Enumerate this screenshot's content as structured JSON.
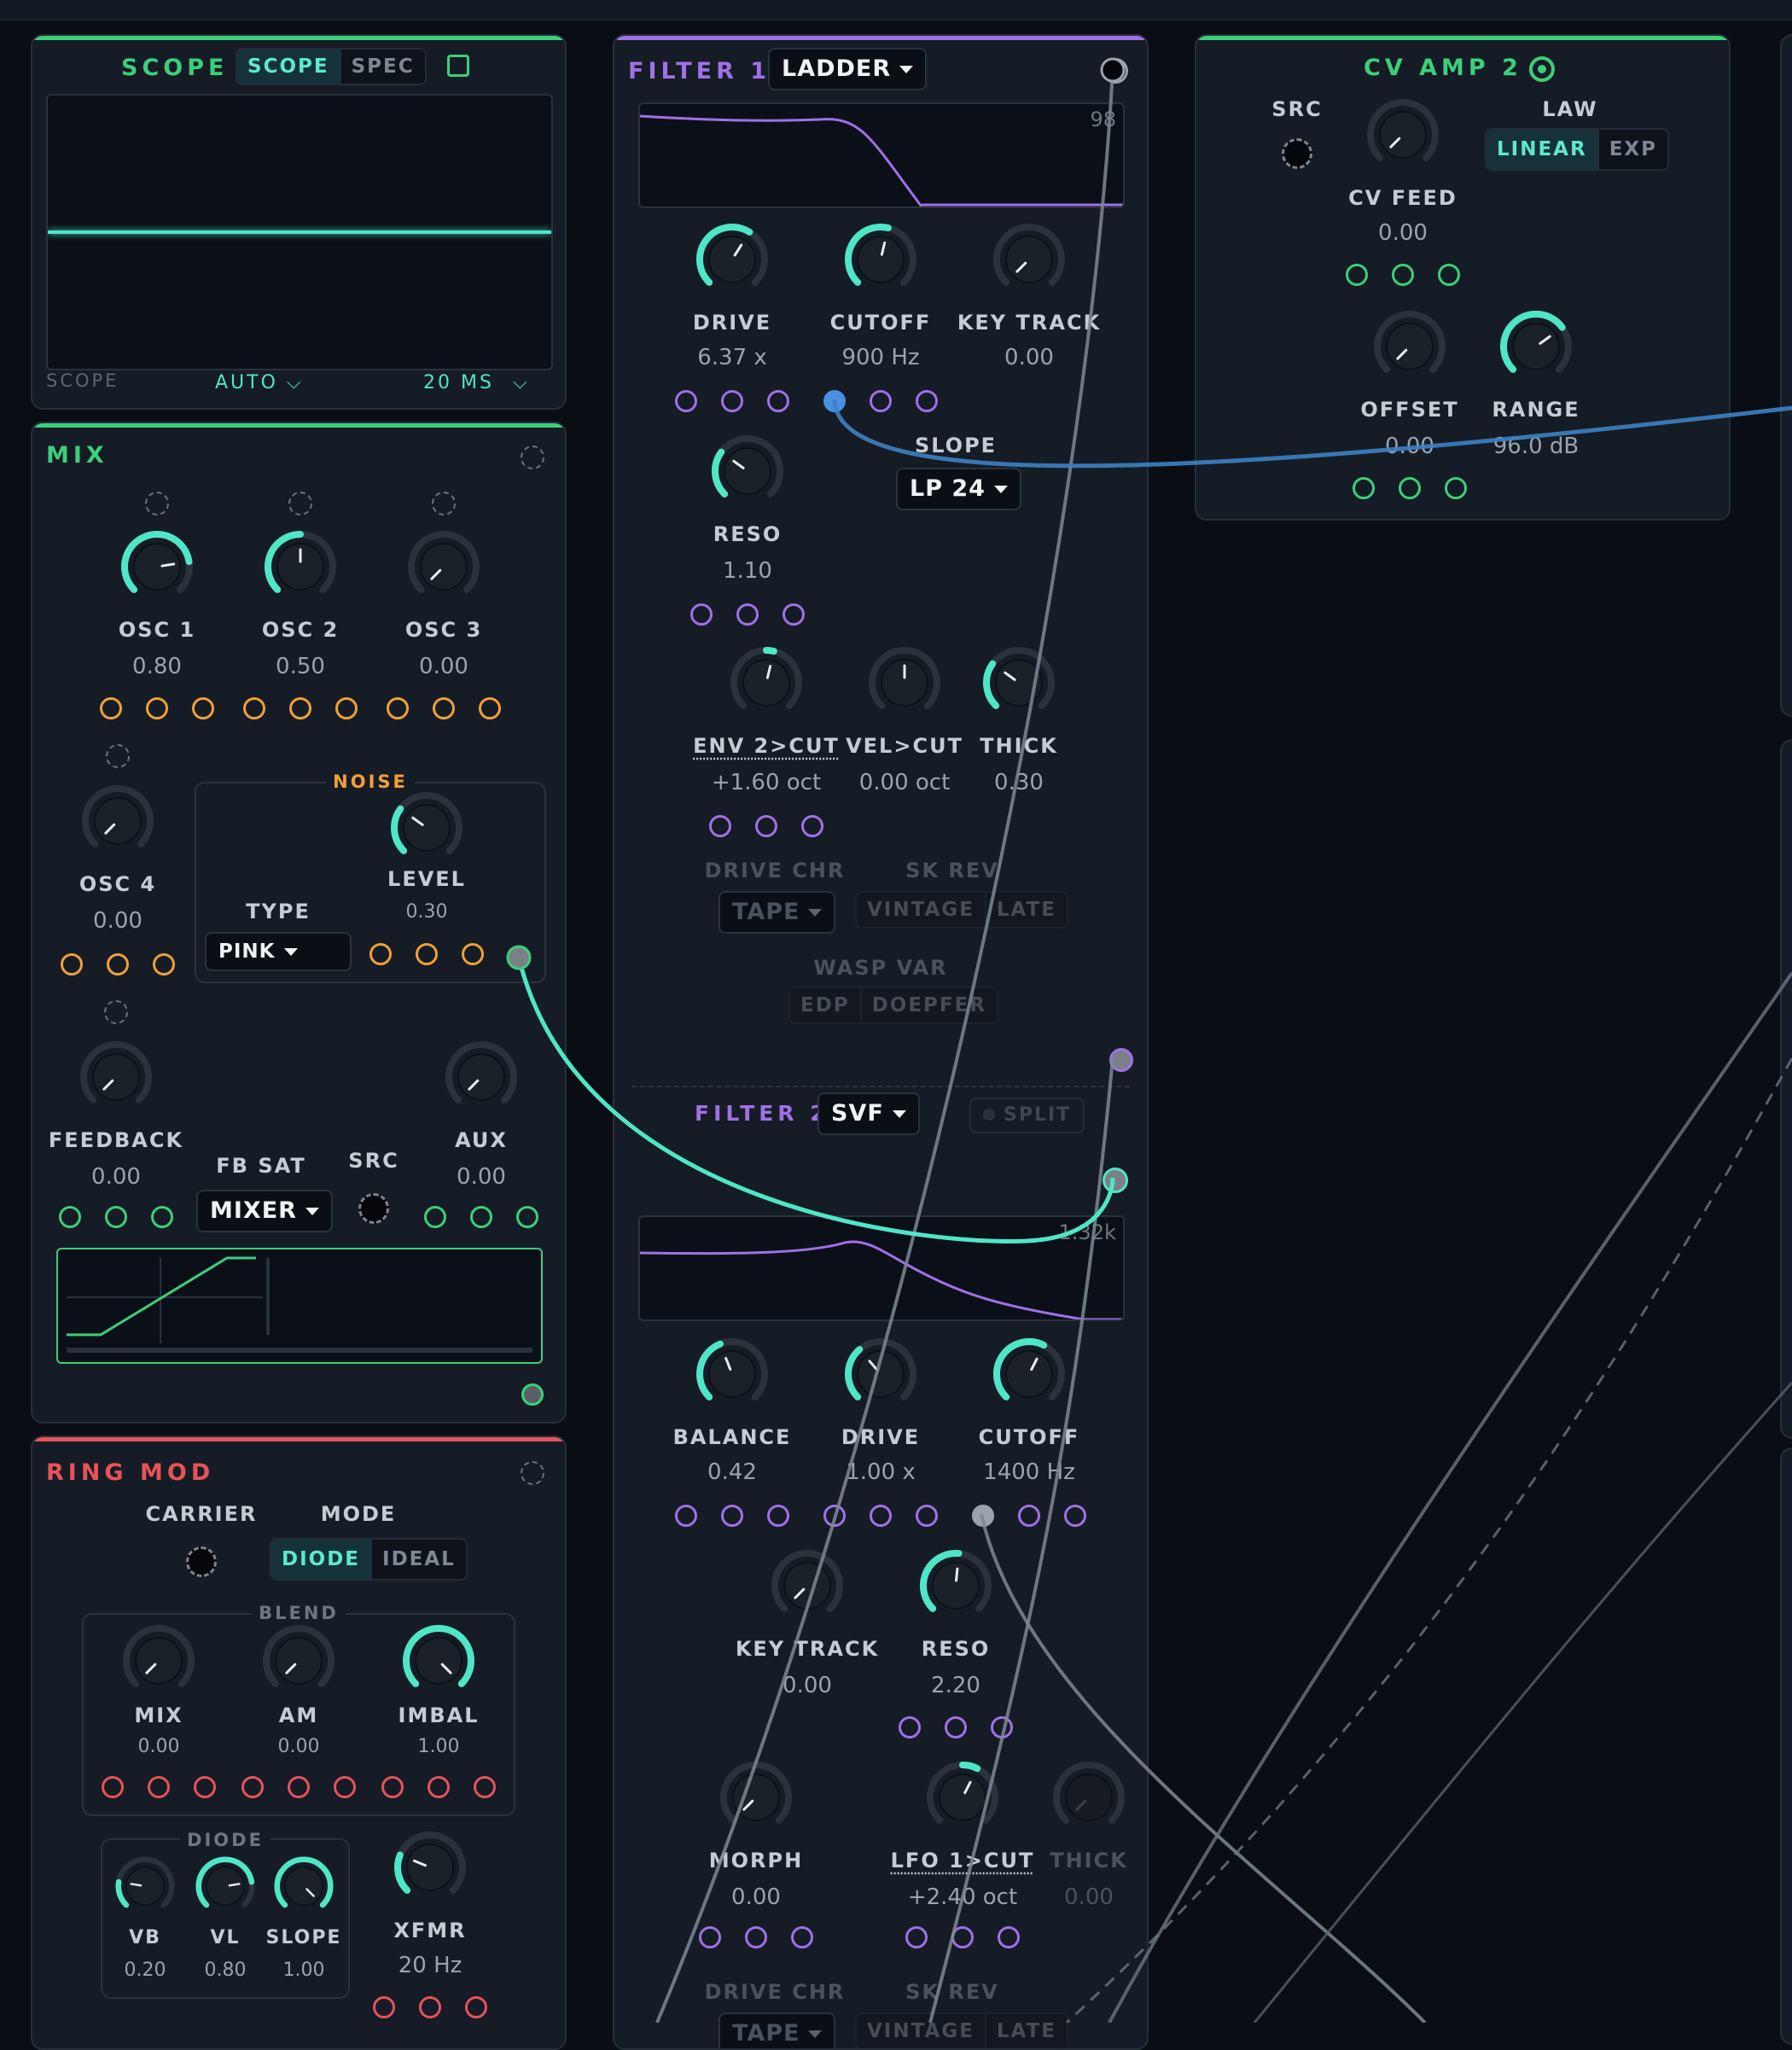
{
  "scope": {
    "title": "SCOPE",
    "tabs": [
      "SCOPE",
      "SPEC"
    ],
    "footer_label": "SCOPE",
    "mode": "AUTO",
    "time": "20 MS"
  },
  "mix": {
    "title": "MIX",
    "osc1": {
      "label": "OSC 1",
      "value": "0.80"
    },
    "osc2": {
      "label": "OSC 2",
      "value": "0.50"
    },
    "osc3": {
      "label": "OSC 3",
      "value": "0.00"
    },
    "osc4": {
      "label": "OSC 4",
      "value": "0.00"
    },
    "noise": {
      "title": "NOISE",
      "type_label": "TYPE",
      "type_value": "PINK",
      "level_label": "LEVEL",
      "level_value": "0.30"
    },
    "feedback": {
      "label": "FEEDBACK",
      "value": "0.00"
    },
    "fb_sat": {
      "label": "FB SAT",
      "value": "MIXER"
    },
    "src_label": "SRC",
    "aux": {
      "label": "AUX",
      "value": "0.00"
    }
  },
  "ring_mod": {
    "title": "RING MOD",
    "carrier_label": "CARRIER",
    "mode_label": "MODE",
    "modes": [
      "DIODE",
      "IDEAL"
    ],
    "blend_label": "BLEND",
    "mix": {
      "label": "MIX",
      "value": "0.00"
    },
    "am": {
      "label": "AM",
      "value": "0.00"
    },
    "imbal": {
      "label": "IMBAL",
      "value": "1.00"
    },
    "diode_label": "DIODE",
    "vb": {
      "label": "VB",
      "value": "0.20"
    },
    "vl": {
      "label": "VL",
      "value": "0.80"
    },
    "slope": {
      "label": "SLOPE",
      "value": "1.00"
    },
    "xfmr": {
      "label": "XFMR",
      "value": "20 Hz"
    }
  },
  "filter1": {
    "title": "FILTER 1",
    "type": "LADDER",
    "graph_value": "98",
    "drive": {
      "label": "DRIVE",
      "value": "6.37 x"
    },
    "cutoff": {
      "label": "CUTOFF",
      "value": "900 Hz"
    },
    "key_track": {
      "label": "KEY TRACK",
      "value": "0.00"
    },
    "slope": {
      "label": "SLOPE",
      "value": "LP 24"
    },
    "reso": {
      "label": "RESO",
      "value": "1.10"
    },
    "env2cut": {
      "label": "ENV 2>CUT",
      "value": "+1.60 oct"
    },
    "velcut": {
      "label": "VEL>CUT",
      "value": "0.00 oct"
    },
    "thick": {
      "label": "THICK",
      "value": "0.30"
    },
    "drive_chr": {
      "label": "DRIVE CHR",
      "value": "TAPE"
    },
    "sk_rev": {
      "label": "SK REV",
      "options": [
        "VINTAGE",
        "LATE"
      ]
    },
    "wasp_var": {
      "label": "WASP VAR",
      "options": [
        "EDP",
        "DOEPFER"
      ]
    }
  },
  "filter2": {
    "title": "FILTER 2",
    "type": "SVF",
    "split": "SPLIT",
    "graph_value": "1.32k",
    "balance": {
      "label": "BALANCE",
      "value": "0.42"
    },
    "drive": {
      "label": "DRIVE",
      "value": "1.00 x"
    },
    "cutoff": {
      "label": "CUTOFF",
      "value": "1400 Hz"
    },
    "key_track": {
      "label": "KEY TRACK",
      "value": "0.00"
    },
    "reso": {
      "label": "RESO",
      "value": "2.20"
    },
    "morph": {
      "label": "MORPH",
      "value": "0.00"
    },
    "lfo1cut": {
      "label": "LFO 1>CUT",
      "value": "+2.40 oct"
    },
    "thick": {
      "label": "THICK",
      "value": "0.00"
    },
    "drive_chr": {
      "label": "DRIVE CHR",
      "value": "TAPE"
    },
    "sk_rev": {
      "label": "SK REV",
      "options": [
        "VINTAGE",
        "LATE"
      ]
    }
  },
  "cv_amp2": {
    "title": "CV AMP 2",
    "src_label": "SRC",
    "law_label": "LAW",
    "law_options": [
      "LINEAR",
      "EXP"
    ],
    "cv_feed": {
      "label": "CV FEED",
      "value": "0.00"
    },
    "offset": {
      "label": "OFFSET",
      "value": "0.00"
    },
    "range": {
      "label": "RANGE",
      "value": "96.0 dB"
    }
  },
  "colors": {
    "teal": "#4fe6c8",
    "green": "#3ccf7a",
    "purple": "#a070e8",
    "orange": "#f0a038",
    "red": "#e8525a",
    "blue": "#3b82c4"
  }
}
